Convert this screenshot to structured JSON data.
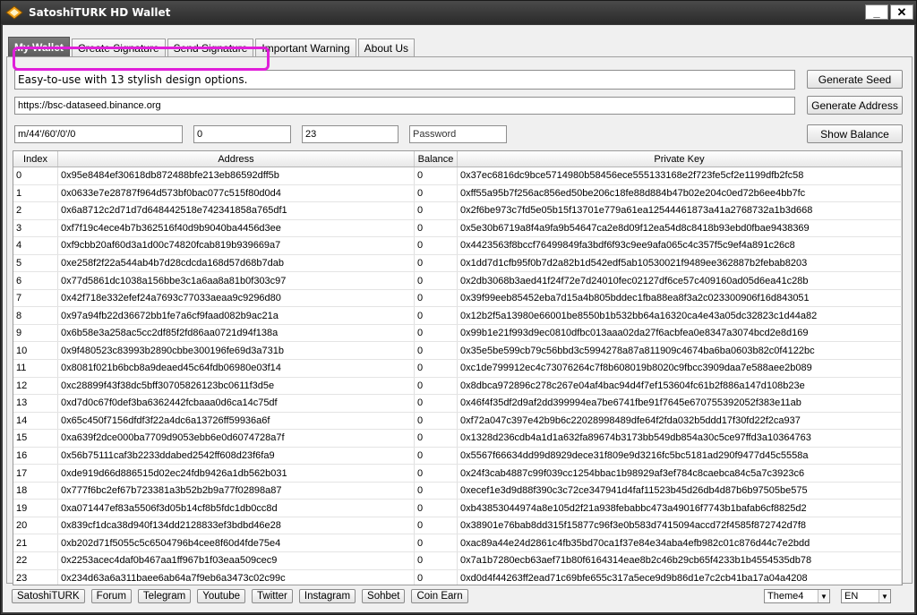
{
  "window": {
    "title": "SatoshiTURK HD Wallet",
    "minimize_label": "_",
    "close_label": "✕"
  },
  "tabs": [
    {
      "label": "My Wallet",
      "active": true
    },
    {
      "label": "Create Signature",
      "active": false
    },
    {
      "label": "Send Signature",
      "active": false
    },
    {
      "label": "Important Warning",
      "active": false
    },
    {
      "label": "About Us",
      "active": false
    }
  ],
  "form": {
    "seed_value": "Easy-to-use with 13 stylish design options.",
    "rpc_url": "https://bsc-dataseed.binance.org",
    "derivation_path": "m/44'/60'/0'/0",
    "start_index": "0",
    "count": "23",
    "password_placeholder": "Password",
    "generate_seed_label": "Generate Seed",
    "generate_address_label": "Generate Address",
    "show_balance_label": "Show Balance"
  },
  "table": {
    "columns": [
      "Index",
      "Address",
      "Balance",
      "Private Key"
    ],
    "rows": [
      [
        "0",
        "0x95e8484ef30618db872488bfe213eb86592dff5b",
        "0",
        "0x37ec6816dc9bce5714980b58456ece555133168e2f723fe5cf2e1199dfb2fc58"
      ],
      [
        "1",
        "0x0633e7e28787f964d573bf0bac077c515f80d0d4",
        "0",
        "0xff55a95b7f256ac856ed50be206c18fe88d884b47b02e204c0ed72b6ee4bb7fc"
      ],
      [
        "2",
        "0x6a8712c2d71d7d648442518e742341858a765df1",
        "0",
        "0x2f6be973c7fd5e05b15f13701e779a61ea12544461873a41a2768732a1b3d668"
      ],
      [
        "3",
        "0xf7f19c4ece4b7b362516f40d9b9040ba4456d3ee",
        "0",
        "0x5e30b6719a8f4a9fa9b54647ca2e8d09f12ea54d8c8418b93ebd0fbae9438369"
      ],
      [
        "4",
        "0xf9cbb20af60d3a1d00c74820fcab819b939669a7",
        "0",
        "0x4423563f8bccf76499849fa3bdf6f93c9ee9afa065c4c357f5c9ef4a891c26c8"
      ],
      [
        "5",
        "0xe258f2f22a544ab4b7d28cdcda168d57d68b7dab",
        "0",
        "0x1dd7d1cfb95f0b7d2a82b1d542edf5ab10530021f9489ee362887b2febab8203"
      ],
      [
        "6",
        "0x77d5861dc1038a156bbe3c1a6aa8a81b0f303c97",
        "0",
        "0x2db3068b3aed41f24f72e7d24010fec02127df6ce57c409160ad05d6ea41c28b"
      ],
      [
        "7",
        "0x42f718e332efef24a7693c77033aeaa9c9296d80",
        "0",
        "0x39f99eeb85452eba7d15a4b805bddec1fba88ea8f3a2c023300906f16d843051"
      ],
      [
        "8",
        "0x97a94fb22d36672bb1fe7a6cf9faad082b9ac21a",
        "0",
        "0x12b2f5a13980e66001be8550b1b532bb64a16320ca4e43a05dc32823c1d44a82"
      ],
      [
        "9",
        "0x6b58e3a258ac5cc2df85f2fd86aa0721d94f138a",
        "0",
        "0x99b1e21f993d9ec0810dfbc013aaa02da27f6acbfea0e8347a3074bcd2e8d169"
      ],
      [
        "10",
        "0x9f480523c83993b2890cbbe300196fe69d3a731b",
        "0",
        "0x35e5be599cb79c56bbd3c5994278a87a811909c4674ba6ba0603b82c0f4122bc"
      ],
      [
        "11",
        "0x8081f021b6bcb8a9deaed45c64fdb06980e03f14",
        "0",
        "0xc1de799912ec4c73076264c7f8b608019b8020c9fbcc3909daa7e588aee2b089"
      ],
      [
        "12",
        "0xc28899f43f38dc5bff30705826123bc0611f3d5e",
        "0",
        "0x8dbca972896c278c267e04af4bac94d4f7ef153604fc61b2f886a147d108b23e"
      ],
      [
        "13",
        "0xd7d0c67f0def3ba6362442fcbaaa0d6ca14c75df",
        "0",
        "0x46f4f35df2d9af2dd399994ea7be6741fbe91f7645e670755392052f383e11ab"
      ],
      [
        "14",
        "0x65c450f7156dfdf3f22a4dc6a13726ff59936a6f",
        "0",
        "0xf72a047c397e42b9b6c22028998489dfe64f2fda032b5ddd17f30fd22f2ca937"
      ],
      [
        "15",
        "0xa639f2dce000ba7709d9053ebb6e0d6074728a7f",
        "0",
        "0x1328d236cdb4a1d1a632fa89674b3173bb549db854a30c5ce97ffd3a10364763"
      ],
      [
        "16",
        "0x56b75111caf3b2233ddabed2542ff608d23f6fa9",
        "0",
        "0x5567f66634dd99d8929dece31f809e9d3216fc5bc5181ad290f9477d45c5558a"
      ],
      [
        "17",
        "0xde919d66d886515d02ec24fdb9426a1db562b031",
        "0",
        "0x24f3cab4887c99f039cc1254bbac1b98929af3ef784c8caebca84c5a7c3923c6"
      ],
      [
        "18",
        "0x777f6bc2ef67b723381a3b52b2b9a77f02898a87",
        "0",
        "0xecef1e3d9d88f390c3c72ce347941d4faf11523b45d26db4d87b6b97505be575"
      ],
      [
        "19",
        "0xa071447ef83a5506f3d05b14cf8b5fdc1db0cc8d",
        "0",
        "0xb43853044974a8e105d2f21a938febabbc473a49016f7743b1bafab6cf8825d2"
      ],
      [
        "20",
        "0x839cf1dca38d940f134dd2128833ef3bdbd46e28",
        "0",
        "0x38901e76bab8dd315f15877c96f3e0b583d7415094accd72f4585f872742d7f8"
      ],
      [
        "21",
        "0xb202d71f5055c5c6504796b4cee8f60d4fde75e4",
        "0",
        "0xac89a44e24d2861c4fb35bd70ca1f37e84e34aba4efb982c01c876d44c7e2bdd"
      ],
      [
        "22",
        "0x2253acec4daf0b467aa1ff967b1f03eaa509cec9",
        "0",
        "0x7a1b7280ecb63aef71b80f6164314eae8b2c46b29cb65f4233b1b4554535db78"
      ],
      [
        "23",
        "0x234d63a6a311baee6ab64a7f9eb6a3473c02c99c",
        "0",
        "0xd0d4f44263ff2ead71c69bfe655c317a5ece9d9b86d1e7c2cb41ba17a04a4208"
      ]
    ]
  },
  "footer": {
    "links": [
      "SatoshiTURK",
      "Forum",
      "Telegram",
      "Youtube",
      "Twitter",
      "Instagram",
      "Sohbet",
      "Coin Earn"
    ],
    "theme_selected": "Theme4",
    "language_selected": "EN"
  },
  "colors": {
    "highlight": "#e01fd9",
    "active_tab": "#5c5c5c",
    "title_bar": "#2a2a2a"
  }
}
